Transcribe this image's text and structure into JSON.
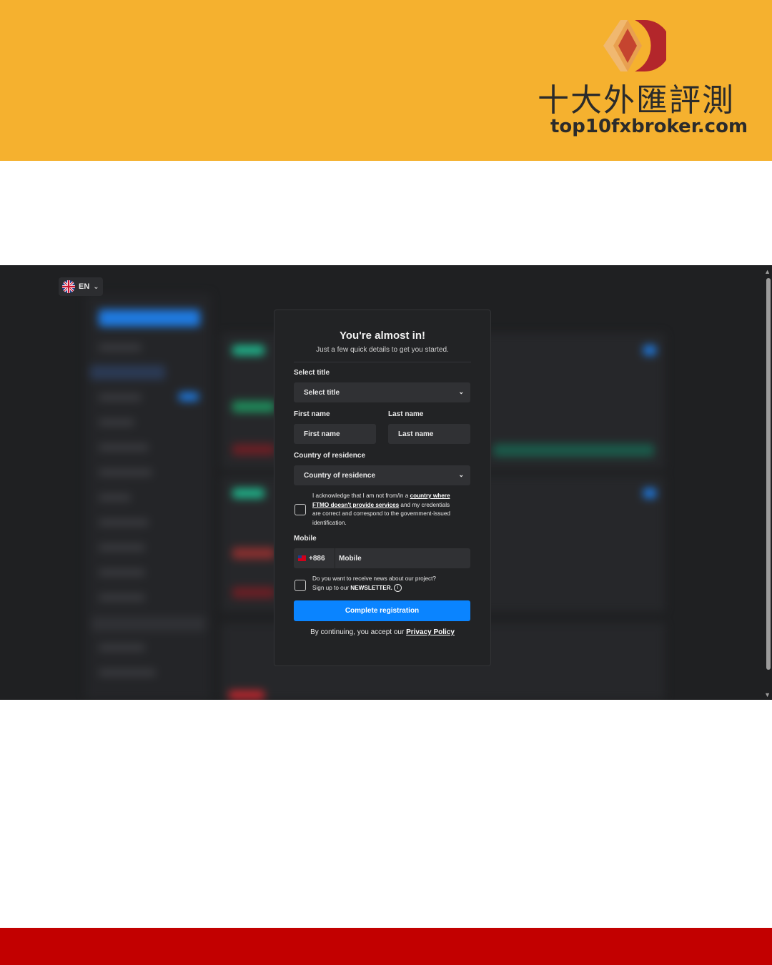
{
  "brand": {
    "name_cn": "十大外匯評測",
    "url": "top10fxbroker.com",
    "banner_color": "#f5b12f",
    "footer_color": "#c20000"
  },
  "language": {
    "code": "EN",
    "flag_icon": "uk-flag-icon"
  },
  "modal": {
    "title": "You're almost in!",
    "subtitle": "Just a few quick details to get you started.",
    "select_title_label": "Select title",
    "select_title_value": "Select title",
    "first_name_label": "First name",
    "first_name_placeholder": "First name",
    "last_name_label": "Last name",
    "last_name_placeholder": "Last name",
    "country_label": "Country of residence",
    "country_placeholder": "Country of residence",
    "ack_text_1": "I acknowledge that I am not from/in a ",
    "ack_link": "country where FTMO doesn't provide services",
    "ack_text_2": " and my credentials are correct and correspond to the government-issued identification.",
    "mobile_label": "Mobile",
    "mobile_prefix": "+886",
    "mobile_placeholder": "Mobile",
    "newsletter_text_1": "Do you want to receive news about our project?",
    "newsletter_text_2": "Sign up to our ",
    "newsletter_bold": "NEWSLETTER.",
    "submit_label": "Complete registration",
    "consent_text": "By continuing, you accept our ",
    "consent_link": "Privacy Policy",
    "accent_color": "#0a84ff"
  }
}
